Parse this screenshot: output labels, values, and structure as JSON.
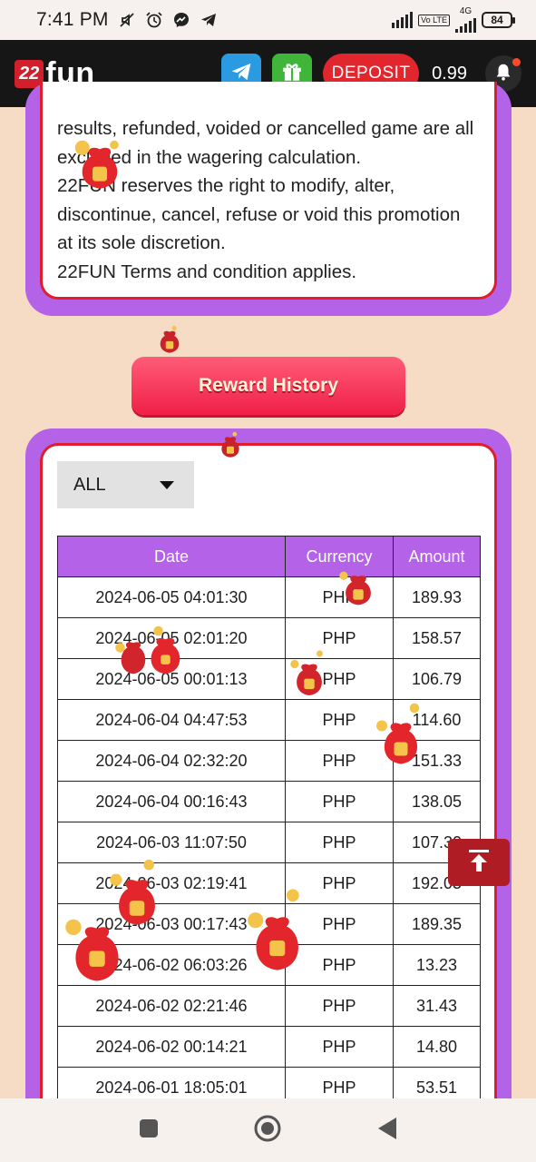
{
  "status_bar": {
    "time": "7:41 PM",
    "network_label": "4G",
    "volte_label": "Vo LTE",
    "battery": "84",
    "icons": [
      "mute-icon",
      "alarm-icon",
      "messenger-icon",
      "telegram-icon",
      "signal-icon",
      "battery-icon"
    ]
  },
  "header": {
    "logo_badge": "22",
    "logo_word": "fun",
    "deposit_label": "DEPOSIT",
    "balance": "0.99"
  },
  "terms": {
    "lines": [
      "results, refunded, voided or cancelled game are all",
      "excluded in the wagering calculation.",
      "22FUN reserves the right to modify, alter,",
      "discontinue, cancel, refuse or void this promotion",
      "at its sole discretion.",
      "22FUN Terms and condition applies."
    ]
  },
  "reward_history": {
    "button_label": "Reward History",
    "filter_selected": "ALL",
    "columns": [
      "Date",
      "Currency",
      "Amount"
    ],
    "rows": [
      [
        "2024-06-05 04:01:30",
        "PHP",
        "189.93"
      ],
      [
        "2024-06-05 02:01:20",
        "PHP",
        "158.57"
      ],
      [
        "2024-06-05 00:01:13",
        "PHP",
        "106.79"
      ],
      [
        "2024-06-04 04:47:53",
        "PHP",
        "114.60"
      ],
      [
        "2024-06-04 02:32:20",
        "PHP",
        "151.33"
      ],
      [
        "2024-06-04 00:16:43",
        "PHP",
        "138.05"
      ],
      [
        "2024-06-03 11:07:50",
        "PHP",
        "107.30"
      ],
      [
        "2024-06-03 02:19:41",
        "PHP",
        "192.05"
      ],
      [
        "2024-06-03 00:17:43",
        "PHP",
        "189.35"
      ],
      [
        "2024-06-02 06:03:26",
        "PHP",
        "13.23"
      ],
      [
        "2024-06-02 02:21:46",
        "PHP",
        "31.43"
      ],
      [
        "2024-06-02 00:14:21",
        "PHP",
        "14.80"
      ],
      [
        "2024-06-01 18:05:01",
        "PHP",
        "53.51"
      ],
      [
        "",
        "",
        ""
      ]
    ]
  },
  "colors": {
    "accent_purple": "#b462e8",
    "accent_red": "#e01d2a",
    "header_bg": "#161616",
    "page_bg": "#f6dcc4"
  }
}
